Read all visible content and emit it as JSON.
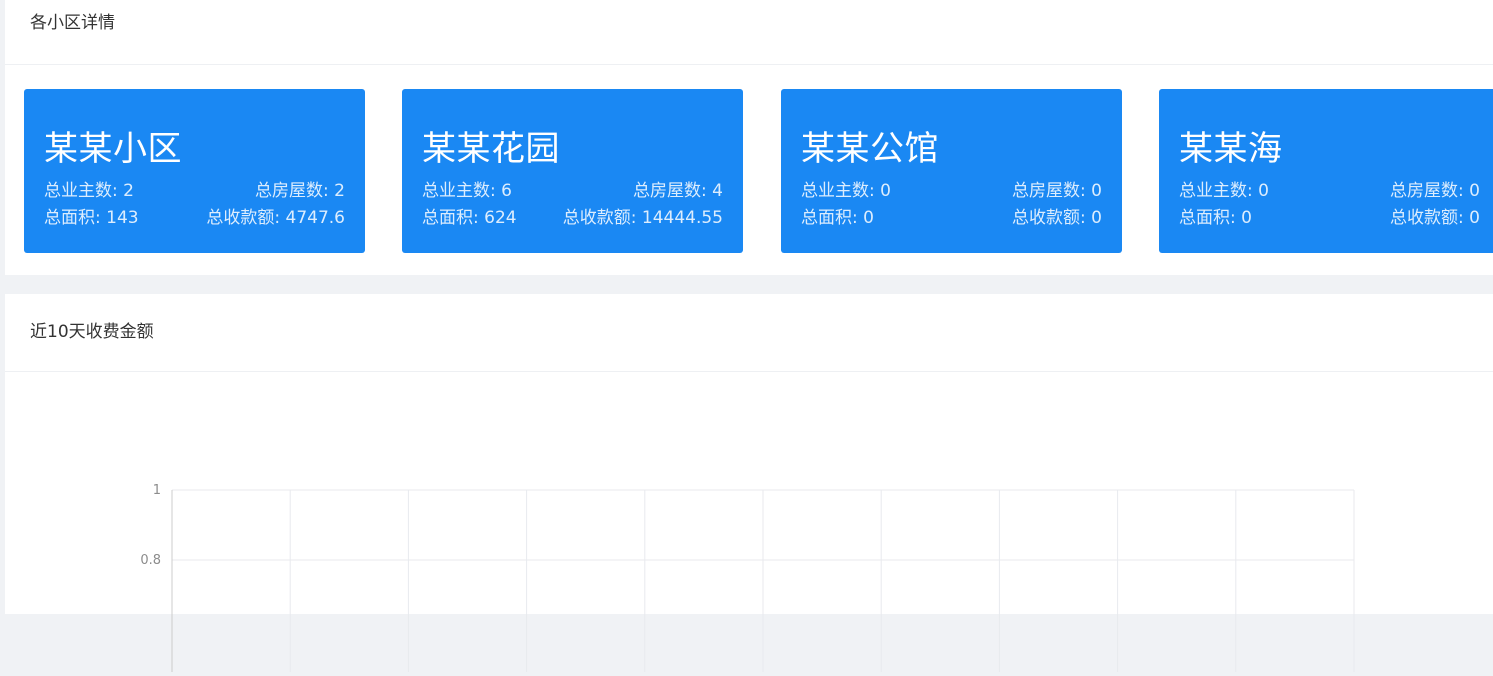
{
  "communities_section": {
    "title": "各小区详情",
    "cards": [
      {
        "name": "某某小区",
        "owners_label": "总业主数: 2",
        "houses_label": "总房屋数: 2",
        "area_label": "总面积: 143",
        "revenue_label": "总收款额: 4747.6"
      },
      {
        "name": "某某花园",
        "owners_label": "总业主数: 6",
        "houses_label": "总房屋数: 4",
        "area_label": "总面积: 624",
        "revenue_label": "总收款额: 14444.55"
      },
      {
        "name": "某某公馆",
        "owners_label": "总业主数: 0",
        "houses_label": "总房屋数: 0",
        "area_label": "总面积: 0",
        "revenue_label": "总收款额: 0"
      },
      {
        "name": "某某海",
        "owners_label": "总业主数: 0",
        "houses_label": "总房屋数: 0",
        "area_label": "总面积: 0",
        "revenue_label": "总收款额: 0"
      }
    ]
  },
  "chart_section": {
    "title": "近10天收费金额"
  },
  "colors": {
    "card_background": "#1a88f3",
    "page_background": "#f0f2f5",
    "grid": "#e8eaee",
    "axis": "#cccccc"
  },
  "chart_data": {
    "type": "line",
    "title": "近10天收费金额",
    "x": [],
    "series": [],
    "ylim": [
      0,
      1
    ],
    "y_ticks_visible": [
      "1",
      "0.8"
    ],
    "x_divisions": 10,
    "grid": true
  }
}
